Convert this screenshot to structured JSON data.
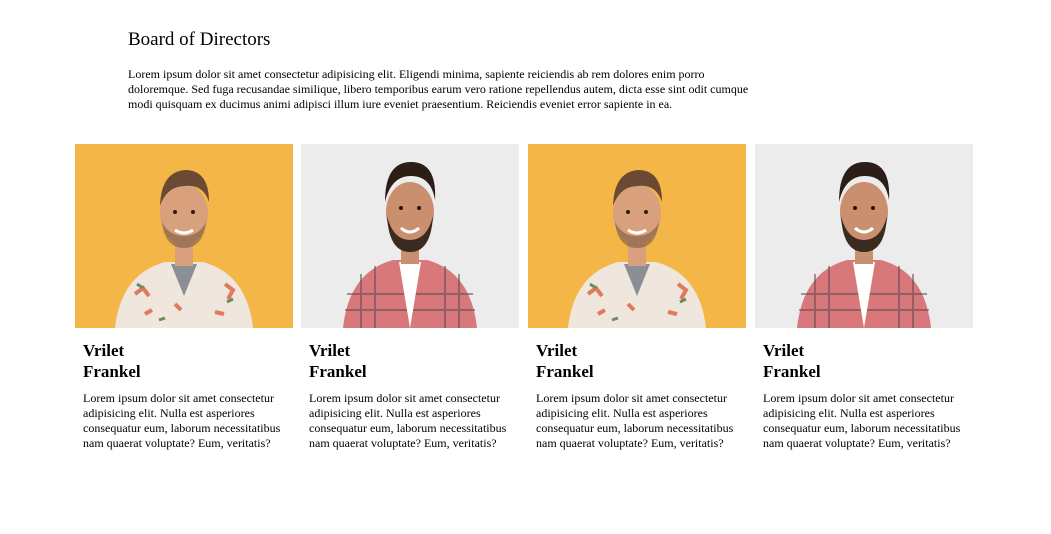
{
  "section": {
    "title": "Board of Directors",
    "description": "Lorem ipsum dolor sit amet consectetur adipisicing elit. Eligendi minima, sapiente reiciendis ab rem dolores enim porro doloremque. Sed fuga recusandae similique, libero temporibus earum vero ratione repellendus autem, dicta esse sint odit cumque modi quisquam ex ducimus animi adipisci illum iure eveniet praesentium. Reiciendis eveniet error sapiente in ea."
  },
  "colors": {
    "yellow_bg": "#f3b240",
    "gray_bg": "#e6e6e6",
    "shirt_plaid": "#d9787a",
    "shirt_floral": "#efe7dd",
    "skin": "#d9a07e",
    "hair": "#3b2a20"
  },
  "directors": [
    {
      "first_name": "Vrilet",
      "last_name": "Frankel",
      "bio": "Lorem ipsum dolor sit amet consectetur adipisicing elit. Nulla est asperiores consequatur eum, laborum necessitatibus nam quaerat voluptate? Eum, veritatis?",
      "photo_style": "yellow"
    },
    {
      "first_name": "Vrilet",
      "last_name": "Frankel",
      "bio": "Lorem ipsum dolor sit amet consectetur adipisicing elit. Nulla est asperiores consequatur eum, laborum necessitatibus nam quaerat voluptate? Eum, veritatis?",
      "photo_style": "gray"
    },
    {
      "first_name": "Vrilet",
      "last_name": "Frankel",
      "bio": "Lorem ipsum dolor sit amet consectetur adipisicing elit. Nulla est asperiores consequatur eum, laborum necessitatibus nam quaerat voluptate? Eum, veritatis?",
      "photo_style": "yellow"
    },
    {
      "first_name": "Vrilet",
      "last_name": "Frankel",
      "bio": "Lorem ipsum dolor sit amet consectetur adipisicing elit. Nulla est asperiores consequatur eum, laborum necessitatibus nam quaerat voluptate? Eum, veritatis?",
      "photo_style": "gray"
    }
  ]
}
